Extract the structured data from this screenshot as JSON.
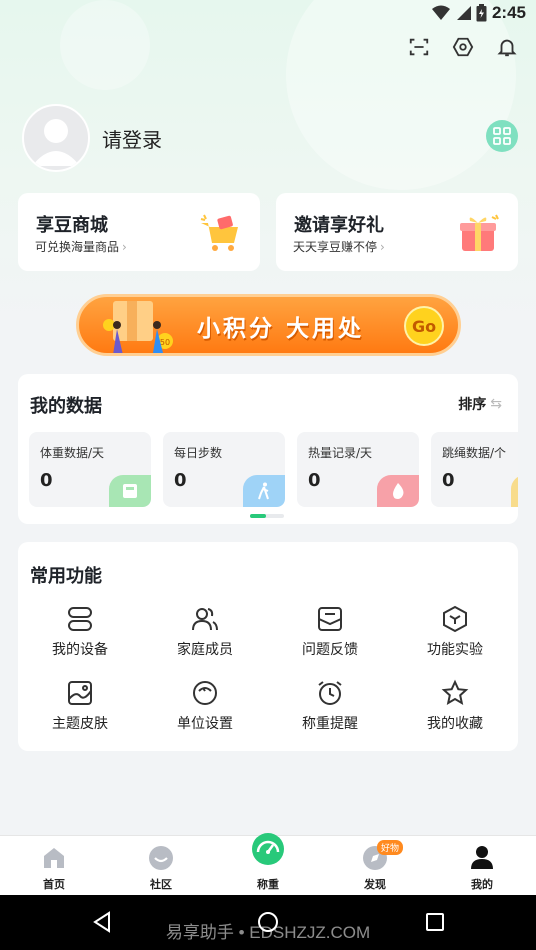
{
  "status_bar": {
    "time": "2:45"
  },
  "profile": {
    "login_text": "请登录"
  },
  "promos": [
    {
      "title": "享豆商城",
      "subtitle": "可兑换海量商品"
    },
    {
      "title": "邀请享好礼",
      "subtitle": "天天享豆赚不停"
    }
  ],
  "banner": {
    "text": "小积分 大用处",
    "go_label": "Go",
    "box_number": "50"
  },
  "my_data": {
    "title": "我的数据",
    "sort_label": "排序",
    "tiles": [
      {
        "label": "体重数据/天",
        "value": "0",
        "color": "#a8e6b4"
      },
      {
        "label": "每日步数",
        "value": "0",
        "color": "#9fd3f7"
      },
      {
        "label": "热量记录/天",
        "value": "0",
        "color": "#f7a1a8"
      },
      {
        "label": "跳绳数据/个",
        "value": "0",
        "color": "#f8dc8c"
      }
    ]
  },
  "common_functions": {
    "title": "常用功能",
    "items": [
      {
        "label": "我的设备",
        "icon": "device-icon"
      },
      {
        "label": "家庭成员",
        "icon": "family-icon"
      },
      {
        "label": "问题反馈",
        "icon": "feedback-icon"
      },
      {
        "label": "功能实验",
        "icon": "experiment-icon"
      },
      {
        "label": "主题皮肤",
        "icon": "theme-icon"
      },
      {
        "label": "单位设置",
        "icon": "unit-icon"
      },
      {
        "label": "称重提醒",
        "icon": "alarm-icon"
      },
      {
        "label": "我的收藏",
        "icon": "star-icon"
      }
    ]
  },
  "bottom_nav": [
    {
      "label": "首页",
      "icon": "home-icon"
    },
    {
      "label": "社区",
      "icon": "community-icon"
    },
    {
      "label": "称重",
      "icon": "scale-icon"
    },
    {
      "label": "发现",
      "icon": "discover-icon",
      "badge": "好物"
    },
    {
      "label": "我的",
      "icon": "profile-icon"
    }
  ],
  "watermark": "易享助手 • EDSHZJZ.COM",
  "colors": {
    "accent": "#28c97a",
    "banner": "#ff7a12"
  }
}
